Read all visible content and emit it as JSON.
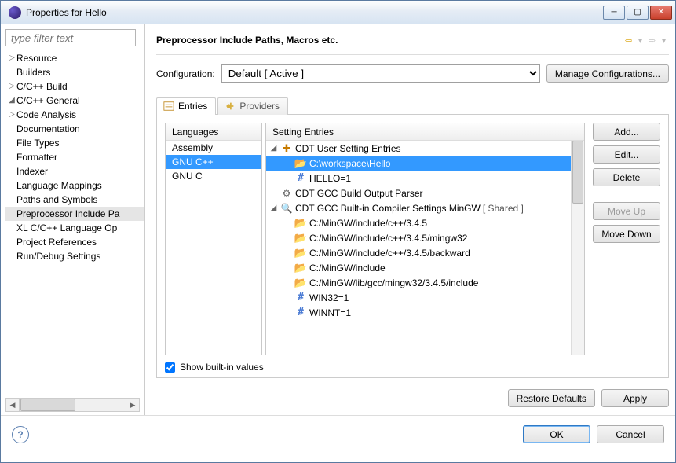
{
  "window": {
    "title": "Properties for Hello"
  },
  "left": {
    "filter_placeholder": "type filter text",
    "tree": [
      {
        "lvl": 0,
        "exp": "r",
        "label": "Resource"
      },
      {
        "lvl": 0,
        "exp": " ",
        "label": "Builders"
      },
      {
        "lvl": 0,
        "exp": "r",
        "label": "C/C++ Build"
      },
      {
        "lvl": 0,
        "exp": "d",
        "label": "C/C++ General"
      },
      {
        "lvl": 1,
        "exp": "r",
        "label": "Code Analysis"
      },
      {
        "lvl": 1,
        "exp": " ",
        "label": "Documentation"
      },
      {
        "lvl": 1,
        "exp": " ",
        "label": "File Types"
      },
      {
        "lvl": 1,
        "exp": " ",
        "label": "Formatter"
      },
      {
        "lvl": 1,
        "exp": " ",
        "label": "Indexer"
      },
      {
        "lvl": 1,
        "exp": " ",
        "label": "Language Mappings"
      },
      {
        "lvl": 1,
        "exp": " ",
        "label": "Paths and Symbols"
      },
      {
        "lvl": 1,
        "exp": " ",
        "label": "Preprocessor Include Paths, Macros etc.",
        "sel": true,
        "clip": "Preprocessor Include Pa"
      },
      {
        "lvl": 1,
        "exp": " ",
        "label": "XL C/C++ Language Options",
        "clip": "XL C/C++ Language Op"
      },
      {
        "lvl": 0,
        "exp": " ",
        "label": "Project References"
      },
      {
        "lvl": 0,
        "exp": " ",
        "label": "Run/Debug Settings"
      }
    ]
  },
  "page": {
    "title": "Preprocessor Include Paths, Macros etc.",
    "cfg_label": "Configuration:",
    "cfg_value": "Default  [ Active ]",
    "manage_btn": "Manage Configurations...",
    "tabs": {
      "entries": "Entries",
      "providers": "Providers"
    },
    "lang_hdr": "Languages",
    "langs": [
      {
        "label": "Assembly"
      },
      {
        "label": "GNU C++",
        "sel": true
      },
      {
        "label": "GNU C"
      }
    ],
    "ent_hdr": "Setting Entries",
    "entries": [
      {
        "lvl": 0,
        "tw": "d",
        "icon": "cdt",
        "label": "CDT User Setting Entries"
      },
      {
        "lvl": 1,
        "tw": " ",
        "icon": "folder",
        "label": "C:\\workspace\\Hello",
        "sel": true
      },
      {
        "lvl": 1,
        "tw": " ",
        "icon": "hash",
        "label": "HELLO=1"
      },
      {
        "lvl": 0,
        "tw": " ",
        "icon": "gear",
        "label": "CDT GCC Build Output Parser"
      },
      {
        "lvl": 0,
        "tw": "d",
        "icon": "mag",
        "label": "CDT GCC Built-in Compiler Settings MinGW",
        "suffix": "  [ Shared ]"
      },
      {
        "lvl": 1,
        "tw": " ",
        "icon": "folder",
        "label": "C:/MinGW/include/c++/3.4.5"
      },
      {
        "lvl": 1,
        "tw": " ",
        "icon": "folder",
        "label": "C:/MinGW/include/c++/3.4.5/mingw32"
      },
      {
        "lvl": 1,
        "tw": " ",
        "icon": "folder",
        "label": "C:/MinGW/include/c++/3.4.5/backward"
      },
      {
        "lvl": 1,
        "tw": " ",
        "icon": "folder",
        "label": "C:/MinGW/include"
      },
      {
        "lvl": 1,
        "tw": " ",
        "icon": "folder",
        "label": "C:/MinGW/lib/gcc/mingw32/3.4.5/include"
      },
      {
        "lvl": 1,
        "tw": " ",
        "icon": "hash",
        "label": "WIN32=1"
      },
      {
        "lvl": 1,
        "tw": " ",
        "icon": "hash",
        "label": "WINNT=1"
      }
    ],
    "buttons": {
      "add": "Add...",
      "edit": "Edit...",
      "del": "Delete",
      "up": "Move Up",
      "down": "Move Down"
    },
    "show_builtin": "Show built-in values",
    "restore": "Restore Defaults",
    "apply": "Apply",
    "ok": "OK",
    "cancel": "Cancel"
  }
}
